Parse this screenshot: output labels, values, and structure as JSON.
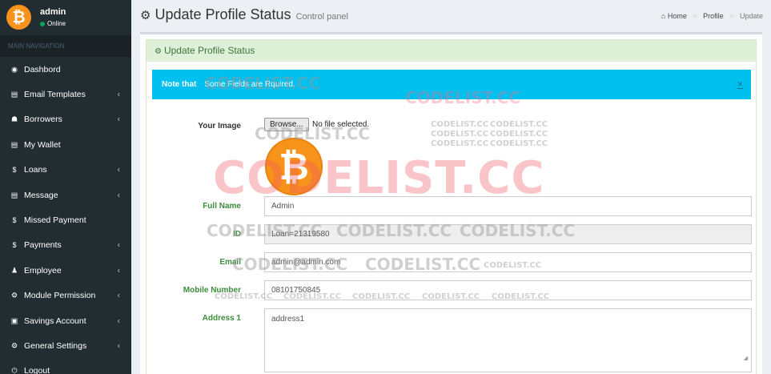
{
  "user": {
    "name": "admin",
    "status": "Online",
    "avatar_glyph": "₿"
  },
  "sidebar": {
    "header": "MAIN NAVIGATION",
    "items": [
      {
        "label": "Dashbord",
        "icon": "dashboard-icon",
        "glyph": "◉",
        "has_submenu": false
      },
      {
        "label": "Email Templates",
        "icon": "book-icon",
        "glyph": "▤",
        "has_submenu": true
      },
      {
        "label": "Borrowers",
        "icon": "users-icon",
        "glyph": "☗",
        "has_submenu": true
      },
      {
        "label": "My Wallet",
        "icon": "book-icon",
        "glyph": "▤",
        "has_submenu": false
      },
      {
        "label": "Loans",
        "icon": "dollar-icon",
        "glyph": "$",
        "has_submenu": true
      },
      {
        "label": "Message",
        "icon": "book-icon",
        "glyph": "▤",
        "has_submenu": true
      },
      {
        "label": "Missed Payment",
        "icon": "dollar-icon",
        "glyph": "$",
        "has_submenu": false
      },
      {
        "label": "Payments",
        "icon": "dollar-icon",
        "glyph": "$",
        "has_submenu": true
      },
      {
        "label": "Employee",
        "icon": "user-icon",
        "glyph": "♟",
        "has_submenu": true
      },
      {
        "label": "Module Permission",
        "icon": "cogs-icon",
        "glyph": "⚙",
        "has_submenu": true
      },
      {
        "label": "Savings Account",
        "icon": "money-icon",
        "glyph": "▣",
        "has_submenu": true
      },
      {
        "label": "General Settings",
        "icon": "gear-icon",
        "glyph": "⚙",
        "has_submenu": true
      },
      {
        "label": "Logout",
        "icon": "logout-icon",
        "glyph": "⏻",
        "has_submenu": false
      }
    ]
  },
  "header": {
    "title": "Update Profile Status",
    "subtitle": "Control panel"
  },
  "breadcrumb": {
    "home": "Home",
    "profile": "Profile",
    "current": "Update"
  },
  "box": {
    "heading": "Update Profile Status"
  },
  "alert": {
    "strong": "Note that",
    "text": "Some Fields are Rquired.",
    "close": "×"
  },
  "form": {
    "image_label": "Your Image",
    "browse_label": "Browse...",
    "file_status": "No file selected.",
    "full_name_label": "Full Name",
    "full_name_value": "Admin",
    "id_label": "ID",
    "id_value": "Loan=21319580",
    "email_label": "Email",
    "email_value": "admin@admin.com",
    "mobile_label": "Mobile Number",
    "mobile_value": "08101750845",
    "address1_label": "Address 1",
    "address1_value": "address1"
  },
  "watermark": "CODELIST.CC",
  "colors": {
    "sidebar": "#222d32",
    "alert": "#00c0ef",
    "heading_bg": "#dff0d8",
    "label_green": "#3c8d3c",
    "bitcoin": "#f7931a"
  }
}
